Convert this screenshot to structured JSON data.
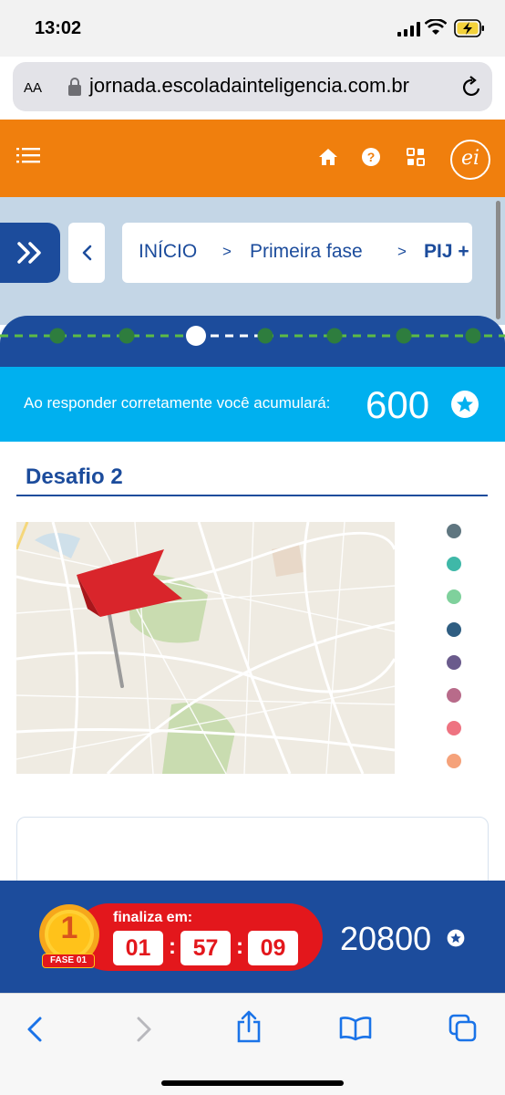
{
  "status_bar": {
    "time": "13:02"
  },
  "browser": {
    "text_size_label": "AA",
    "url": "jornada.escoladainteligencia.com.br"
  },
  "header": {
    "logo_text": "ei"
  },
  "breadcrumb": {
    "items": [
      "INÍCIO",
      "Primeira fase",
      "PIJ +"
    ],
    "separator": ">"
  },
  "progress": {
    "total_steps": 10,
    "current_step": 3
  },
  "points_banner": {
    "label": "Ao responder corretamente você acumulará:",
    "value": "600"
  },
  "challenge": {
    "title": "Desafio 2",
    "palette": [
      "#5f7680",
      "#3fb8a8",
      "#7fd19c",
      "#2f5e82",
      "#6a5b8c",
      "#b86b8a",
      "#ee7381",
      "#f5a27a"
    ]
  },
  "timer": {
    "label": "finaliza em:",
    "hours": "01",
    "minutes": "57",
    "seconds": "09",
    "phase_number": "1",
    "phase_label": "FASE 01"
  },
  "score": {
    "total": "20800"
  },
  "colors": {
    "orange": "#f07f0d",
    "navy": "#1c4c9c",
    "cyan": "#00b0ef",
    "red": "#e3171c",
    "green_dot": "#2e7d3e",
    "green_dash": "#5dbb46"
  }
}
